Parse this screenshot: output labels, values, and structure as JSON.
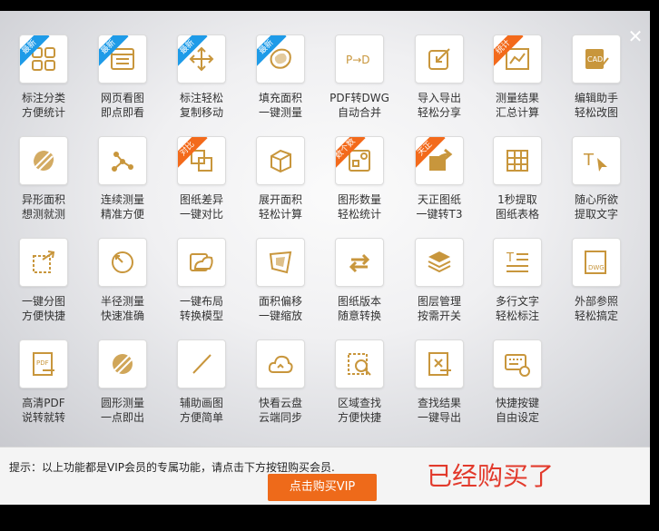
{
  "window": {
    "close_icon": "close-icon"
  },
  "accent": "#c8963c",
  "ribbon_colors": {
    "blue": "#1e9be8",
    "orange": "#f36a1b"
  },
  "features": [
    {
      "line1": "标注分类",
      "line2": "方便统计",
      "badge": "最新",
      "badge_color": "blue",
      "icon": "four-squares-icon"
    },
    {
      "line1": "网页看图",
      "line2": "即点即看",
      "badge": "最新",
      "badge_color": "blue",
      "icon": "browser-window-icon"
    },
    {
      "line1": "标注轻松",
      "line2": "复制移动",
      "badge": "最新",
      "badge_color": "blue",
      "icon": "move-arrows-icon"
    },
    {
      "line1": "填充面积",
      "line2": "一键测量",
      "badge": "最新",
      "badge_color": "blue",
      "icon": "fill-area-icon"
    },
    {
      "line1": "PDF转DWG",
      "line2": "自动合并",
      "badge": "",
      "badge_color": "",
      "icon": "pdf-to-dwg-icon"
    },
    {
      "line1": "导入导出",
      "line2": "轻松分享",
      "badge": "",
      "badge_color": "",
      "icon": "import-export-icon"
    },
    {
      "line1": "测量结果",
      "line2": "汇总计算",
      "badge": "统计",
      "badge_color": "orange",
      "icon": "measure-summary-icon"
    },
    {
      "line1": "编辑助手",
      "line2": "轻松改图",
      "badge": "",
      "badge_color": "",
      "icon": "cad-edit-icon"
    },
    {
      "line1": "异形面积",
      "line2": "想测就测",
      "badge": "",
      "badge_color": "",
      "icon": "irregular-area-icon"
    },
    {
      "line1": "连续测量",
      "line2": "精准方便",
      "badge": "",
      "badge_color": "",
      "icon": "continuous-measure-icon"
    },
    {
      "line1": "图纸差异",
      "line2": "一键对比",
      "badge": "对比",
      "badge_color": "orange",
      "icon": "compare-icon"
    },
    {
      "line1": "展开面积",
      "line2": "轻松计算",
      "badge": "",
      "badge_color": "",
      "icon": "unfold-area-icon"
    },
    {
      "line1": "图形数量",
      "line2": "轻松统计",
      "badge": "数个数",
      "badge_color": "orange",
      "icon": "shape-count-icon"
    },
    {
      "line1": "天正图纸",
      "line2": "一键转T3",
      "badge": "天正",
      "badge_color": "orange",
      "icon": "share-arrow-icon"
    },
    {
      "line1": "1秒提取",
      "line2": "图纸表格",
      "badge": "",
      "badge_color": "",
      "icon": "table-extract-icon"
    },
    {
      "line1": "随心所欲",
      "line2": "提取文字",
      "badge": "",
      "badge_color": "",
      "icon": "text-extract-icon"
    },
    {
      "line1": "一键分图",
      "line2": "方便快捷",
      "badge": "",
      "badge_color": "",
      "icon": "split-drawing-icon"
    },
    {
      "line1": "半径测量",
      "line2": "快速准确",
      "badge": "",
      "badge_color": "",
      "icon": "radius-icon"
    },
    {
      "line1": "一键布局",
      "line2": "转换模型",
      "badge": "",
      "badge_color": "",
      "icon": "layout-convert-icon"
    },
    {
      "line1": "面积偏移",
      "line2": "一键缩放",
      "badge": "",
      "badge_color": "",
      "icon": "area-offset-icon"
    },
    {
      "line1": "图纸版本",
      "line2": "随意转换",
      "badge": "",
      "badge_color": "",
      "icon": "version-convert-icon"
    },
    {
      "line1": "图层管理",
      "line2": "按需开关",
      "badge": "",
      "badge_color": "",
      "icon": "layers-icon"
    },
    {
      "line1": "多行文字",
      "line2": "轻松标注",
      "badge": "",
      "badge_color": "",
      "icon": "multiline-text-icon"
    },
    {
      "line1": "外部参照",
      "line2": "轻松搞定",
      "badge": "",
      "badge_color": "",
      "icon": "xref-dwg-icon"
    },
    {
      "line1": "高清PDF",
      "line2": "说转就转",
      "badge": "",
      "badge_color": "",
      "icon": "pdf-export-icon"
    },
    {
      "line1": "圆形测量",
      "line2": "一点即出",
      "badge": "",
      "badge_color": "",
      "icon": "circle-measure-icon"
    },
    {
      "line1": "辅助画图",
      "line2": "方便简单",
      "badge": "",
      "badge_color": "",
      "icon": "draw-line-icon"
    },
    {
      "line1": "快看云盘",
      "line2": "云端同步",
      "badge": "",
      "badge_color": "",
      "icon": "cloud-icon"
    },
    {
      "line1": "区域查找",
      "line2": "方便快捷",
      "badge": "",
      "badge_color": "",
      "icon": "area-search-icon"
    },
    {
      "line1": "查找结果",
      "line2": "一键导出",
      "badge": "",
      "badge_color": "",
      "icon": "search-export-icon"
    },
    {
      "line1": "快捷按键",
      "line2": "自由设定",
      "badge": "",
      "badge_color": "",
      "icon": "keyboard-settings-icon"
    }
  ],
  "footer": {
    "notice": "提示：以上功能都是VIP会员的专属功能，请点击下方按钮购买会员.",
    "buy_button": "点击购买VIP",
    "annotation": "已经购买了"
  }
}
